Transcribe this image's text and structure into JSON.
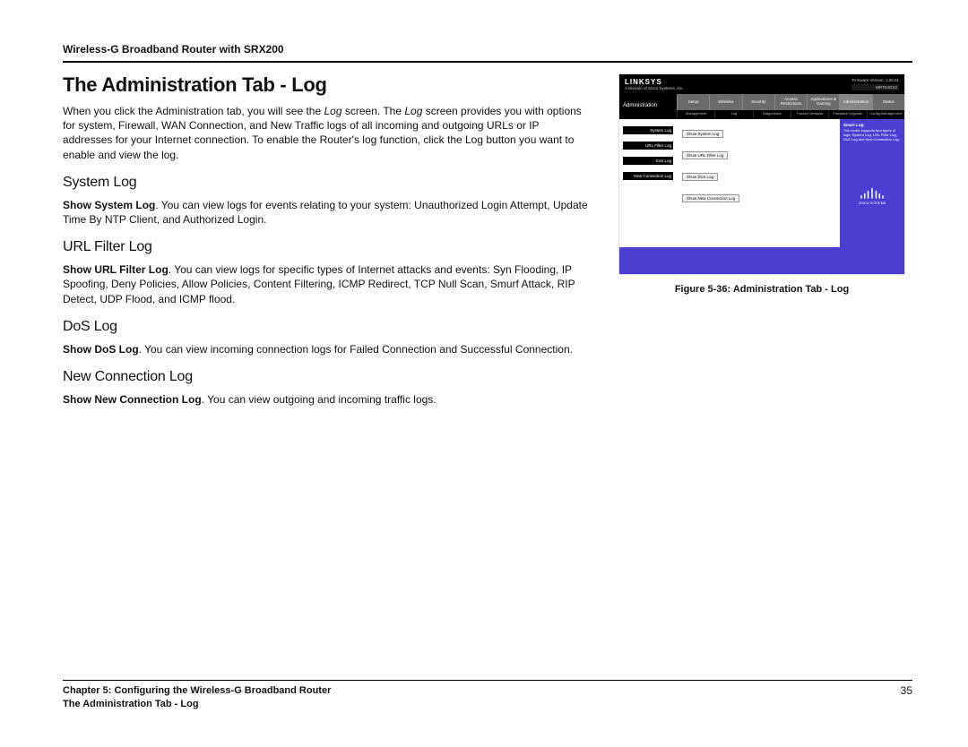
{
  "header": {
    "product": "Wireless-G Broadband Router with SRX200"
  },
  "title": "The Administration Tab - Log",
  "intro": {
    "pre": "When you click the Administration tab, you will see the ",
    "log1": "Log",
    "mid1": " screen. The ",
    "log2": "Log",
    "post": " screen provides you with options for system, Firewall, WAN Connection, and New Traffic logs of all incoming and outgoing URLs or IP addresses for your Internet connection. To enable the Router's log function, click the Log button you want to enable and view the log."
  },
  "sections": {
    "system": {
      "heading": "System Log",
      "lead": "Show System Log",
      "rest": ". You can view logs for events relating to your system: Unauthorized Login Attempt, Update Time By NTP Client, and Authorized Login."
    },
    "url": {
      "heading": "URL Filter Log",
      "lead": "Show URL Filter Log",
      "rest": ". You can view logs for specific types of Internet attacks and events: Syn Flooding, IP Spoofing, Deny Policies, Allow Policies, Content Filtering, ICMP Redirect, TCP Null Scan, Smurf Attack, RIP Detect, UDP Flood, and ICMP flood."
    },
    "dos": {
      "heading": "DoS Log",
      "lead": "Show DoS Log",
      "rest": ". You can view incoming connection logs for Failed Connection and Successful Connection."
    },
    "newconn": {
      "heading": "New Connection Log",
      "lead": "Show New Connection Log",
      "rest": ". You can view outgoing and incoming traffic logs."
    }
  },
  "figure": {
    "caption": "Figure 5-36: Administration Tab - Log",
    "brand": "LINKSYS",
    "brand_sub": "A Division of Cisco Systems, Inc.",
    "fw": "Firmware Version: 1.00.01",
    "model": "WRT54GX2",
    "side_title": "Administration",
    "tabs": [
      "Setup",
      "Wireless",
      "Security",
      "Access Restrictions",
      "Applications & Gaming",
      "Administration",
      "Status"
    ],
    "subtabs": [
      "Management",
      "Log",
      "Diagnostics",
      "Factory Defaults",
      "Firmware Upgrade",
      "Config Management"
    ],
    "labels": [
      "System Log",
      "URL Filter Log",
      "DoS Log",
      "New Connection Log"
    ],
    "buttons": [
      "Show System Log",
      "Show URL Filter Log",
      "Show DoS Log",
      "Show New Connection Log"
    ],
    "help_title": "Smart Log:",
    "help_body": "The router supports four types of logs: System Log, URL Filter Log, DoS Log and New Connection Log."
  },
  "footer": {
    "chapter": "Chapter 5: Configuring the Wireless-G Broadband Router",
    "crumb": "The Administration Tab - Log",
    "page": "35"
  }
}
